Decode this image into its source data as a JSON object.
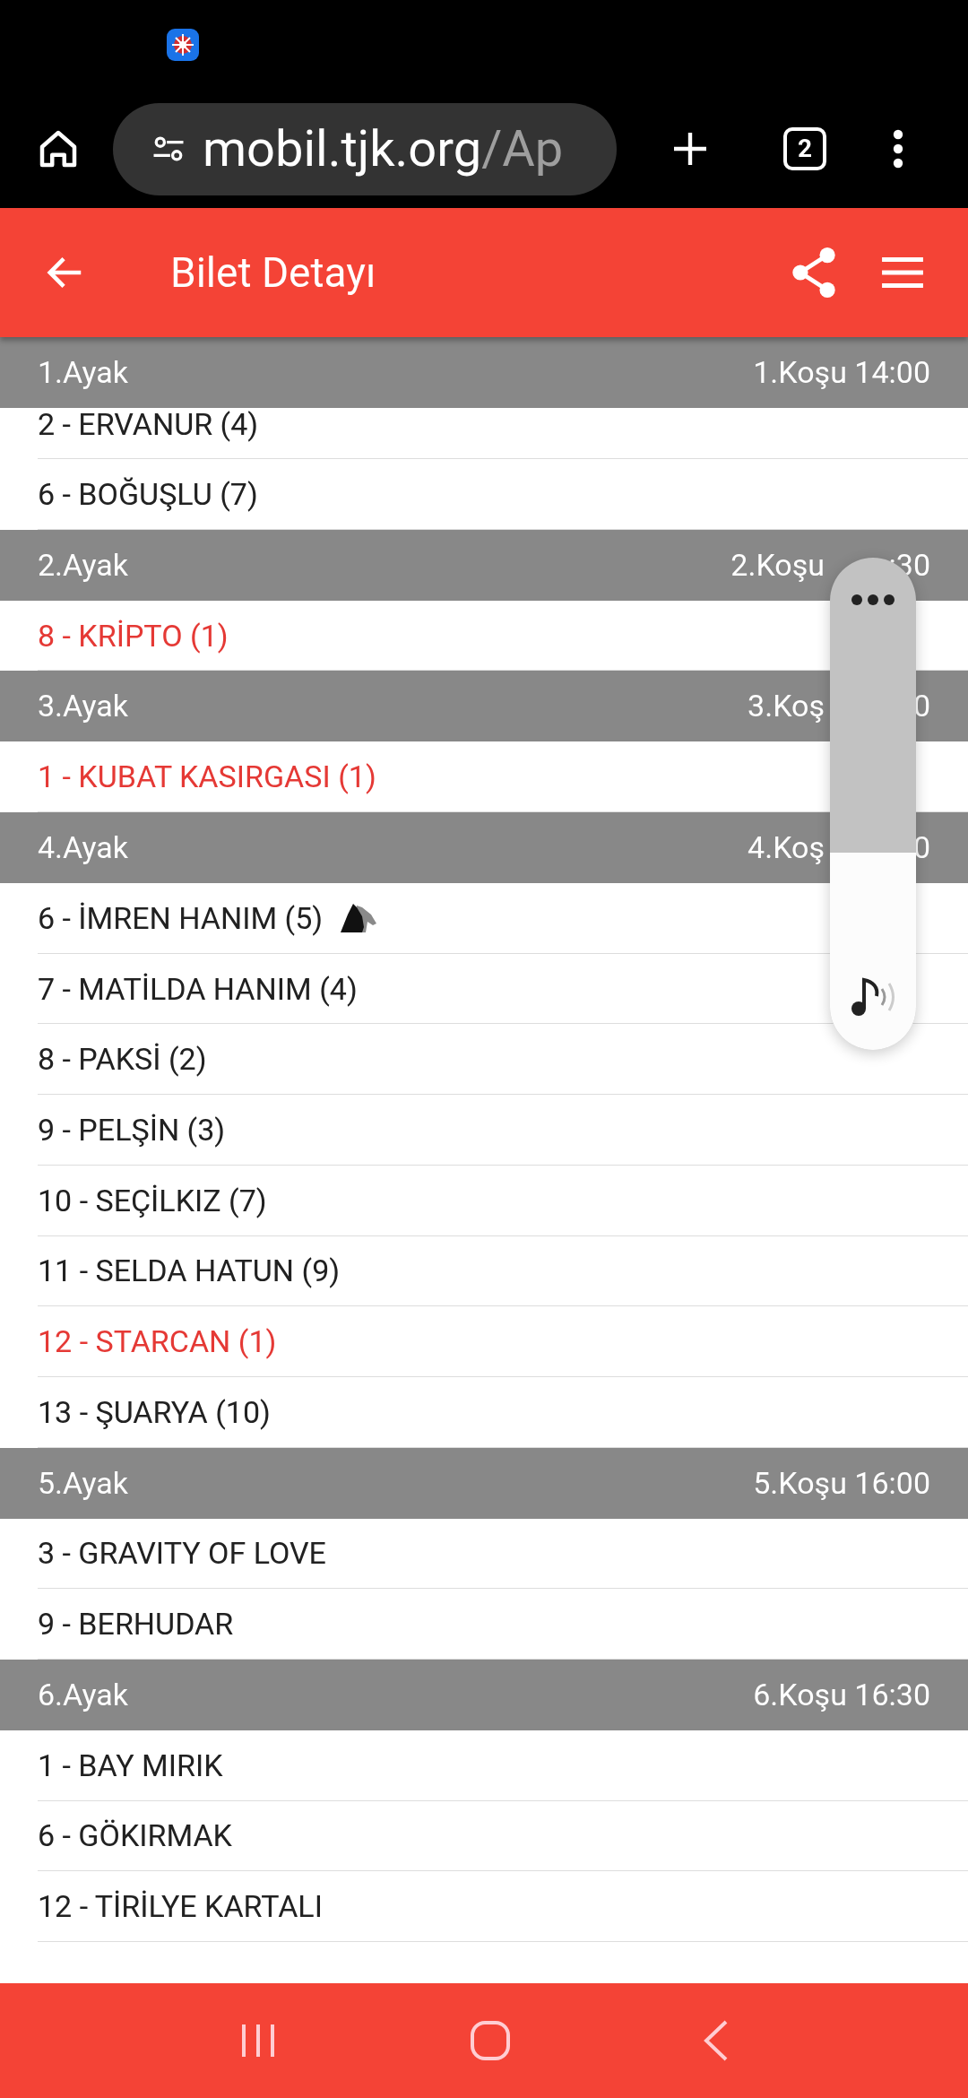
{
  "browser": {
    "url_host": "mobil.tjk.org",
    "url_path": "/Ap",
    "tab_count": "2"
  },
  "app_bar": {
    "title": "Bilet Detayı"
  },
  "legs": [
    {
      "leg": "1.Ayak",
      "race": [
        "1.Koşu 14:00"
      ],
      "horses": [
        {
          "text": "2 - ERVANUR (4)",
          "highlighted": false,
          "has_icon": false
        },
        {
          "text": "6 - BOĞUŞLU (7)",
          "highlighted": false,
          "has_icon": false
        }
      ]
    },
    {
      "leg": "2.Ayak",
      "race": [
        "2.Koşu",
        ":30"
      ],
      "horses": [
        {
          "text": "8 - KRİPTO (1)",
          "highlighted": true,
          "has_icon": false
        }
      ]
    },
    {
      "leg": "3.Ayak",
      "race": [
        "3.Koş",
        "0"
      ],
      "horses": [
        {
          "text": "1 - KUBAT KASIRGASI (1)",
          "highlighted": true,
          "has_icon": false
        }
      ]
    },
    {
      "leg": "4.Ayak",
      "race": [
        "4.Koş",
        "0"
      ],
      "horses": [
        {
          "text": "6 - İMREN HANIM (5)",
          "highlighted": false,
          "has_icon": true
        },
        {
          "text": "7 - MATİLDA HANIM (4)",
          "highlighted": false,
          "has_icon": false
        },
        {
          "text": "8 - PAKSİ (2)",
          "highlighted": false,
          "has_icon": false
        },
        {
          "text": "9 - PELŞİN (3)",
          "highlighted": false,
          "has_icon": false
        },
        {
          "text": "10 - SEÇİLKIZ (7)",
          "highlighted": false,
          "has_icon": false
        },
        {
          "text": "11 - SELDA HATUN (9)",
          "highlighted": false,
          "has_icon": false
        },
        {
          "text": "12 - STARCAN (1)",
          "highlighted": true,
          "has_icon": false
        },
        {
          "text": "13 - ŞUARYA (10)",
          "highlighted": false,
          "has_icon": false
        }
      ]
    },
    {
      "leg": "5.Ayak",
      "race": [
        "5.Koşu 16:00"
      ],
      "horses": [
        {
          "text": "3 - GRAVITY OF LOVE",
          "highlighted": false,
          "has_icon": false
        },
        {
          "text": "9 - BERHUDAR",
          "highlighted": false,
          "has_icon": false
        }
      ]
    },
    {
      "leg": "6.Ayak",
      "race": [
        "6.Koşu 16:30"
      ],
      "horses": [
        {
          "text": "1 - BAY MIRIK",
          "highlighted": false,
          "has_icon": false
        },
        {
          "text": "6 - GÖKIRMAK",
          "highlighted": false,
          "has_icon": false
        },
        {
          "text": "12 - TİRİLYE KARTALI",
          "highlighted": false,
          "has_icon": false
        }
      ]
    }
  ],
  "volume_panel": {
    "level": 0.4
  }
}
